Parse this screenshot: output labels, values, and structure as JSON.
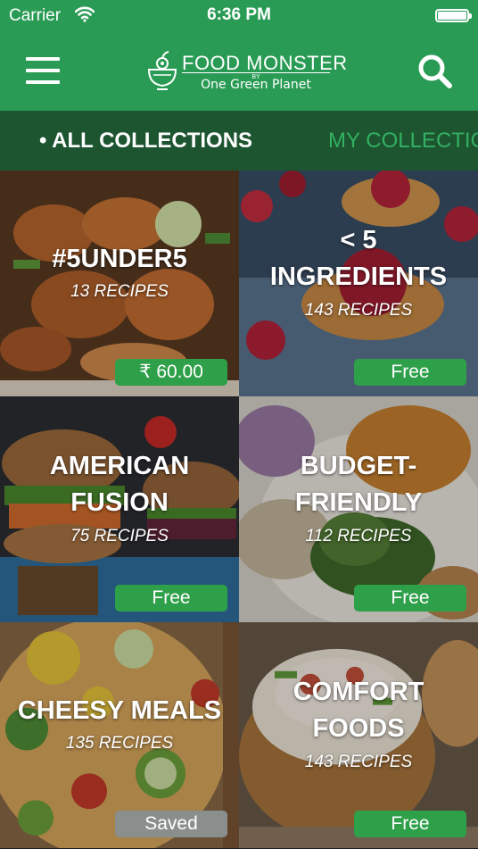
{
  "status_bar": {
    "carrier": "Carrier",
    "time": "6:36 PM",
    "wifi_icon": "wifi-icon",
    "battery_icon": "battery-icon"
  },
  "nav": {
    "menu_icon": "hamburger-menu-icon",
    "logo_title": "FOOD MONSTER",
    "logo_by": "BY",
    "logo_sub": "One Green Planet",
    "search_icon": "search-icon"
  },
  "tabs": [
    {
      "label": "• ALL COLLECTIONS",
      "active": true
    },
    {
      "label": "MY COLLECTIONS",
      "active": false
    }
  ],
  "colors": {
    "brand_green": "#2a9b55",
    "tab_bar": "#1c5530",
    "badge_green": "#2fa04a",
    "badge_grey": "#8a8f8e"
  },
  "collections": [
    {
      "title": "#5UNDER5",
      "count": "13 RECIPES",
      "badge": "₹ 60.00",
      "badge_style": "green"
    },
    {
      "title": "< 5 INGREDIENTS",
      "count": "143 RECIPES",
      "badge": "Free",
      "badge_style": "green"
    },
    {
      "title": "AMERICAN FUSION",
      "count": "75 RECIPES",
      "badge": "Free",
      "badge_style": "green"
    },
    {
      "title": "BUDGET-FRIENDLY",
      "count": "112 RECIPES",
      "badge": "Free",
      "badge_style": "green"
    },
    {
      "title": "CHEESY MEALS",
      "count": "135 RECIPES",
      "badge": "Saved",
      "badge_style": "grey"
    },
    {
      "title": "COMFORT FOODS",
      "count": "143 RECIPES",
      "badge": "Free",
      "badge_style": "green"
    }
  ]
}
